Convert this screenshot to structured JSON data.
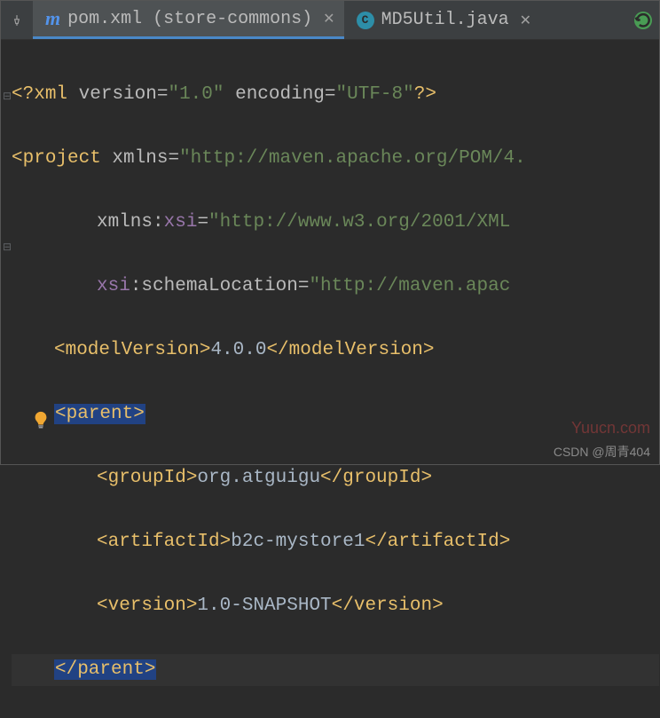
{
  "tabs": {
    "active": {
      "icon": "m",
      "label": "pom.xml (store-commons)"
    },
    "inactive": {
      "icon": "c",
      "label": "MD5Util.java"
    }
  },
  "code": {
    "decl_open": "<?",
    "decl_xml": "xml",
    "decl_ver_attr": " version",
    "decl_eq": "=",
    "decl_ver_val": "\"1.0\"",
    "decl_enc_attr": " encoding",
    "decl_enc_val": "\"UTF-8\"",
    "decl_close": "?>",
    "proj_open": "<",
    "proj_tag": "project",
    "proj_xmlns": " xmlns",
    "proj_xmlns_val": "\"http://maven.apache.org/POM/4.",
    "xmlns_ns": "xmlns:",
    "xsi": "xsi",
    "xsi_val": "\"http://www.w3.org/2001/XML",
    "xsi_colon": "xsi",
    "schemaLoc": ":schemaLocation",
    "schemaLoc_val": "\"http://maven.apac",
    "mv_open": "<modelVersion>",
    "mv_text": "4.0.0",
    "mv_close": "</modelVersion>",
    "parent_open": "<parent>",
    "gid_open": "<groupId>",
    "gid_text": "org.atguigu",
    "gid_close": "</groupId>",
    "aid_open": "<artifactId>",
    "aid_text": "b2c-mystore1",
    "aid_close": "</artifactId>",
    "ver_open": "<version>",
    "ver_text": "1.0-SNAPSHOT",
    "ver_close": "</version>",
    "parent_close": "</parent>"
  },
  "watermark": "Yuucn.com",
  "footer": "CSDN @周青404"
}
